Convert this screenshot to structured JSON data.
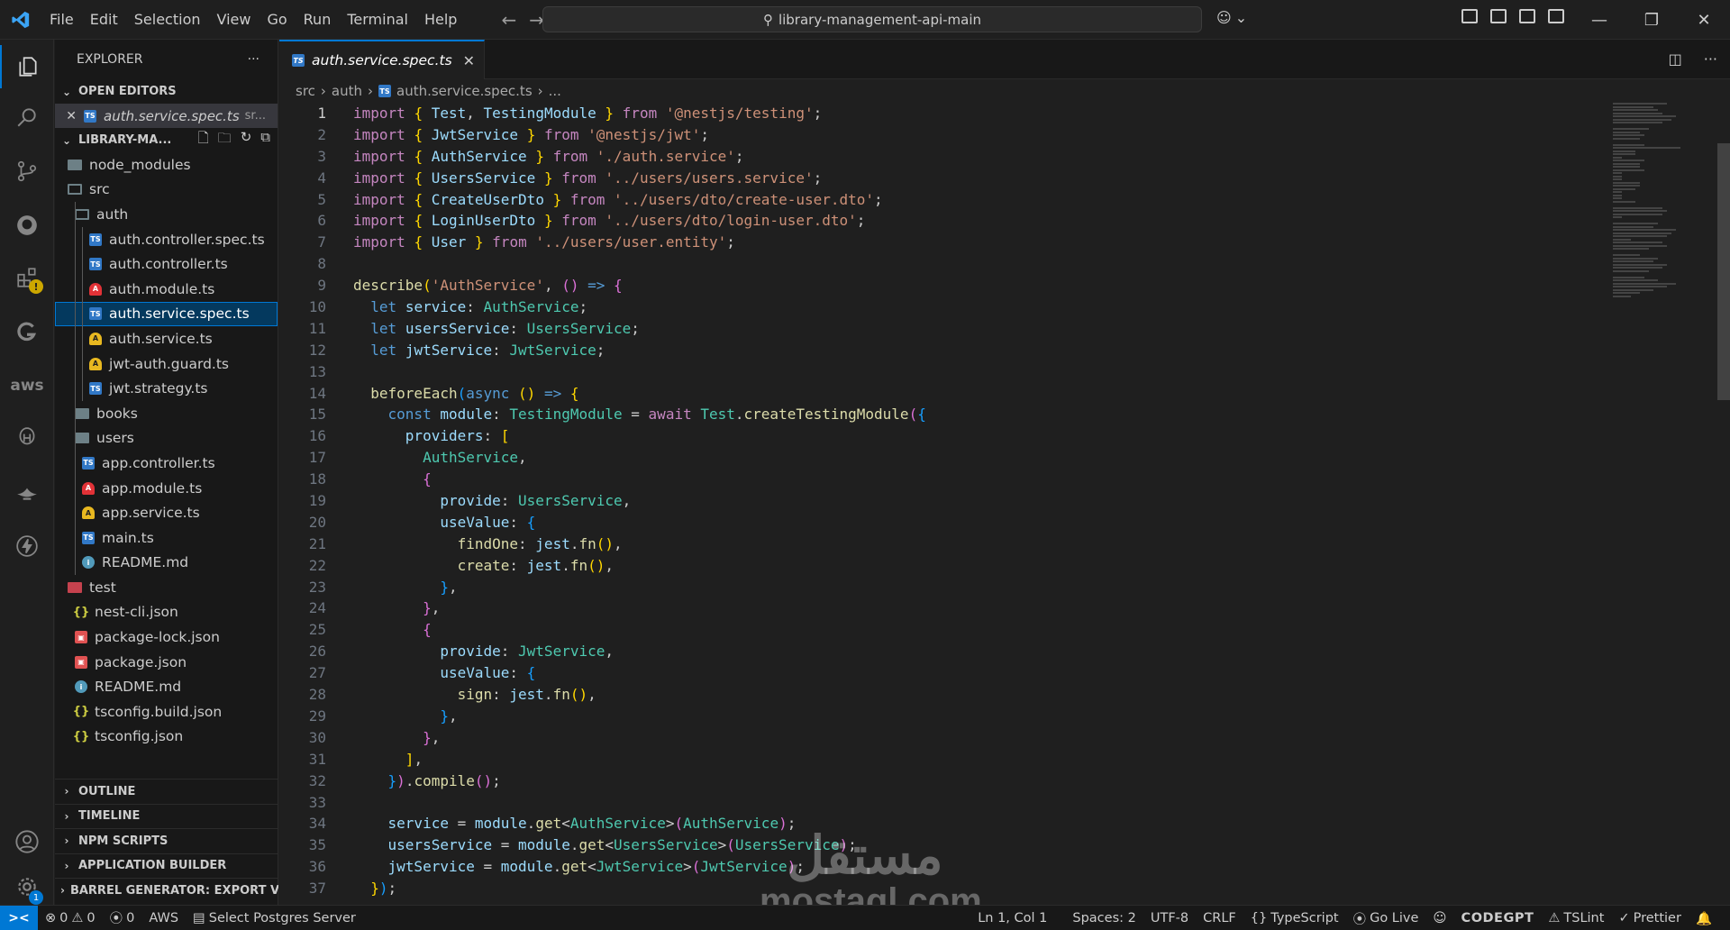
{
  "menu": [
    "File",
    "Edit",
    "Selection",
    "View",
    "Go",
    "Run",
    "Terminal",
    "Help"
  ],
  "search": {
    "text": "library-management-api-main"
  },
  "sidebar": {
    "title": "EXPLORER",
    "open_editors_label": "OPEN EDITORS",
    "open_editor_file": "auth.service.spec.ts",
    "open_editor_dir": "sr...",
    "project_label": "LIBRARY-MA...",
    "tree": [
      {
        "name": "node_modules",
        "type": "folder"
      },
      {
        "name": "src",
        "type": "folder-open"
      },
      {
        "name": "auth",
        "type": "folder-open"
      },
      {
        "name": "auth.controller.spec.ts",
        "type": "ts"
      },
      {
        "name": "auth.controller.ts",
        "type": "ts"
      },
      {
        "name": "auth.module.ts",
        "type": "ng"
      },
      {
        "name": "auth.service.spec.ts",
        "type": "ts"
      },
      {
        "name": "auth.service.ts",
        "type": "svc"
      },
      {
        "name": "jwt-auth.guard.ts",
        "type": "svc"
      },
      {
        "name": "jwt.strategy.ts",
        "type": "ts"
      },
      {
        "name": "books",
        "type": "folder"
      },
      {
        "name": "users",
        "type": "folder"
      },
      {
        "name": "app.controller.ts",
        "type": "ts"
      },
      {
        "name": "app.module.ts",
        "type": "ng"
      },
      {
        "name": "app.service.ts",
        "type": "svc"
      },
      {
        "name": "main.ts",
        "type": "ts"
      },
      {
        "name": "README.md",
        "type": "info"
      },
      {
        "name": "test",
        "type": "folder-red"
      },
      {
        "name": "nest-cli.json",
        "type": "json"
      },
      {
        "name": "package-lock.json",
        "type": "pkg"
      },
      {
        "name": "package.json",
        "type": "pkg"
      },
      {
        "name": "README.md",
        "type": "info"
      },
      {
        "name": "tsconfig.build.json",
        "type": "json"
      },
      {
        "name": "tsconfig.json",
        "type": "json"
      }
    ],
    "bottom_sections": [
      "OUTLINE",
      "TIMELINE",
      "NPM SCRIPTS",
      "APPLICATION BUILDER",
      "BARREL GENERATOR: EXPORT V..."
    ]
  },
  "editor": {
    "tab_label": "auth.service.spec.ts",
    "breadcrumb": [
      "src",
      "auth",
      "auth.service.spec.ts",
      "..."
    ],
    "line_numbers": [
      "1",
      "2",
      "3",
      "4",
      "5",
      "6",
      "7",
      "8",
      "9",
      "10",
      "11",
      "12",
      "13",
      "14",
      "15",
      "16",
      "17",
      "18",
      "19",
      "20",
      "21",
      "22",
      "23",
      "24",
      "25",
      "26",
      "27",
      "28",
      "29",
      "30",
      "31",
      "32",
      "33",
      "34",
      "35",
      "36",
      "37"
    ]
  },
  "statusbar": {
    "errors": "0",
    "warnings": "0",
    "ports": "0",
    "aws": "AWS",
    "postgres": "Select Postgres Server",
    "position": "Ln 1, Col 1",
    "spaces": "Spaces: 2",
    "encoding": "UTF-8",
    "eol": "CRLF",
    "language": "TypeScript",
    "golive": "Go Live",
    "codegpt": "CODEGPT",
    "tslint": "TSLint",
    "prettier": "Prettier"
  },
  "watermark": {
    "arabic": "مستقل",
    "latin": "mostaql.com"
  }
}
